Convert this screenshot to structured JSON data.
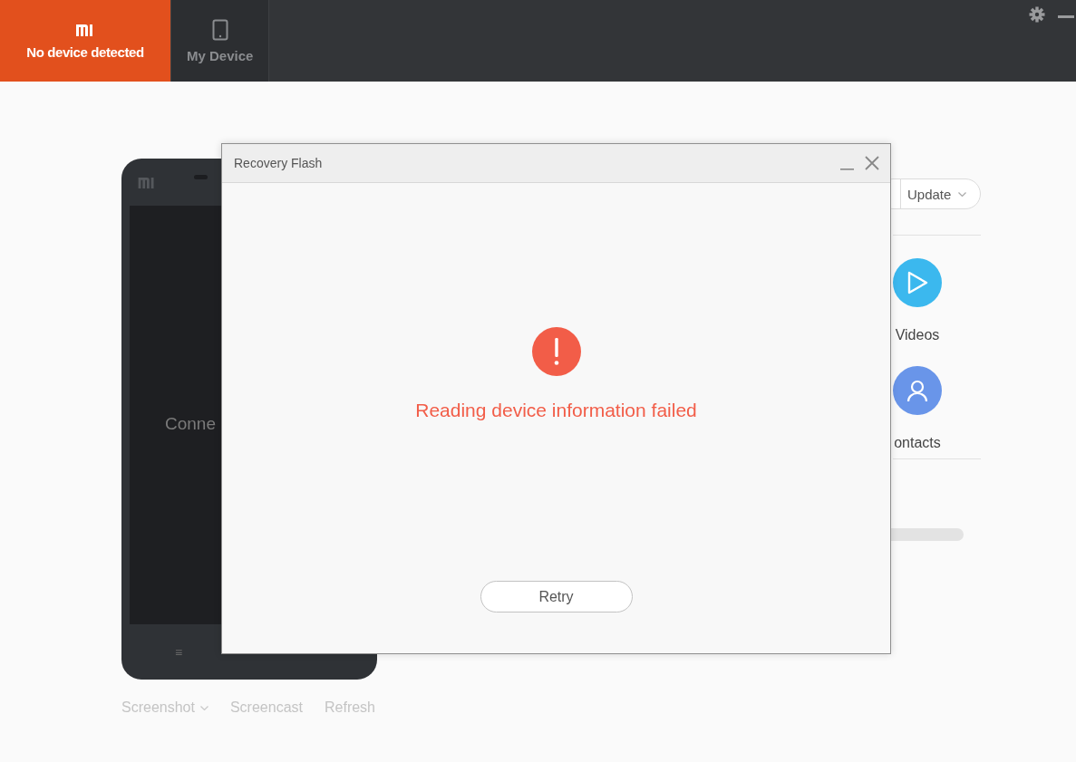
{
  "tabs": [
    {
      "label": "No device detected",
      "selected": true,
      "kind": "mi"
    },
    {
      "label": "My Device",
      "selected": false,
      "kind": "tablet"
    }
  ],
  "phone": {
    "screen_text": "Conne",
    "menu_key": "≡"
  },
  "phone_toolbar": [
    {
      "label": "Screenshot",
      "dropdown": true
    },
    {
      "label": "Screencast",
      "dropdown": false
    },
    {
      "label": "Refresh",
      "dropdown": false
    }
  ],
  "side_panel": {
    "update_button": "Update",
    "shortcuts": [
      {
        "label": "Videos",
        "color": "#3bb8ee",
        "kind": "play"
      },
      {
        "label": "ontacts",
        "color": "#6995e9",
        "kind": "person"
      }
    ]
  },
  "dialog": {
    "title": "Recovery Flash",
    "message": "Reading device information failed",
    "button": "Retry"
  }
}
